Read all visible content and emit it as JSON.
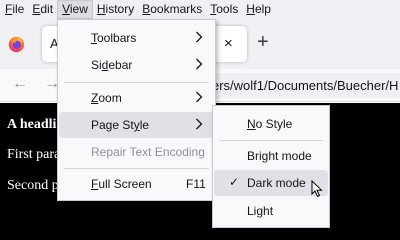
{
  "menubar": {
    "items": [
      {
        "mnemonic": "F",
        "rest": "ile"
      },
      {
        "mnemonic": "E",
        "rest": "dit"
      },
      {
        "mnemonic": "V",
        "rest": "iew"
      },
      {
        "mnemonic": "H",
        "rest": "istory"
      },
      {
        "mnemonic": "B",
        "rest": "ookmarks"
      },
      {
        "mnemonic": "T",
        "rest": "ools"
      },
      {
        "mnemonic": "H",
        "rest": "elp"
      }
    ],
    "active_index": 2
  },
  "tabs": {
    "title": "A",
    "close_glyph": "×",
    "new_tab_glyph": "+"
  },
  "navbar": {
    "back_glyph": "←",
    "forward_glyph": "→",
    "url": "ers/wolf1/Documents/Buecher/H"
  },
  "content": {
    "heading": "A headli",
    "paragraph1": "First para",
    "paragraph2": "Second p"
  },
  "view_menu": {
    "items": [
      {
        "pre": "",
        "mn": "T",
        "post": "oolbars",
        "submenu": true
      },
      {
        "pre": "Si",
        "mn": "d",
        "post": "ebar",
        "submenu": true
      },
      {
        "pre": "",
        "mn": "Z",
        "post": "oom",
        "submenu": true
      },
      {
        "pre": "Page St",
        "mn": "y",
        "post": "le",
        "submenu": true,
        "highlighted": true
      },
      {
        "pre": "Repair Text Encodin",
        "mn": "g",
        "post": "",
        "disabled": true
      },
      {
        "pre": "",
        "mn": "F",
        "post": "ull Screen",
        "shortcut": "F11"
      }
    ]
  },
  "page_style_menu": {
    "items": [
      {
        "pre": "",
        "mn": "N",
        "post": "o Style"
      },
      {
        "pre": "Bright mode",
        "mn": "",
        "post": ""
      },
      {
        "pre": "Dark mode",
        "mn": "",
        "post": "",
        "checked": true,
        "highlighted": true
      },
      {
        "pre": "Light",
        "mn": "",
        "post": ""
      }
    ],
    "check_glyph": "✓"
  },
  "colors": {
    "chrome_bg": "#f0f0f4",
    "menu_bg": "#f9f9fb",
    "menu_hover": "#e0e0e6",
    "page_bg": "#000000",
    "page_text": "#ffffff"
  }
}
